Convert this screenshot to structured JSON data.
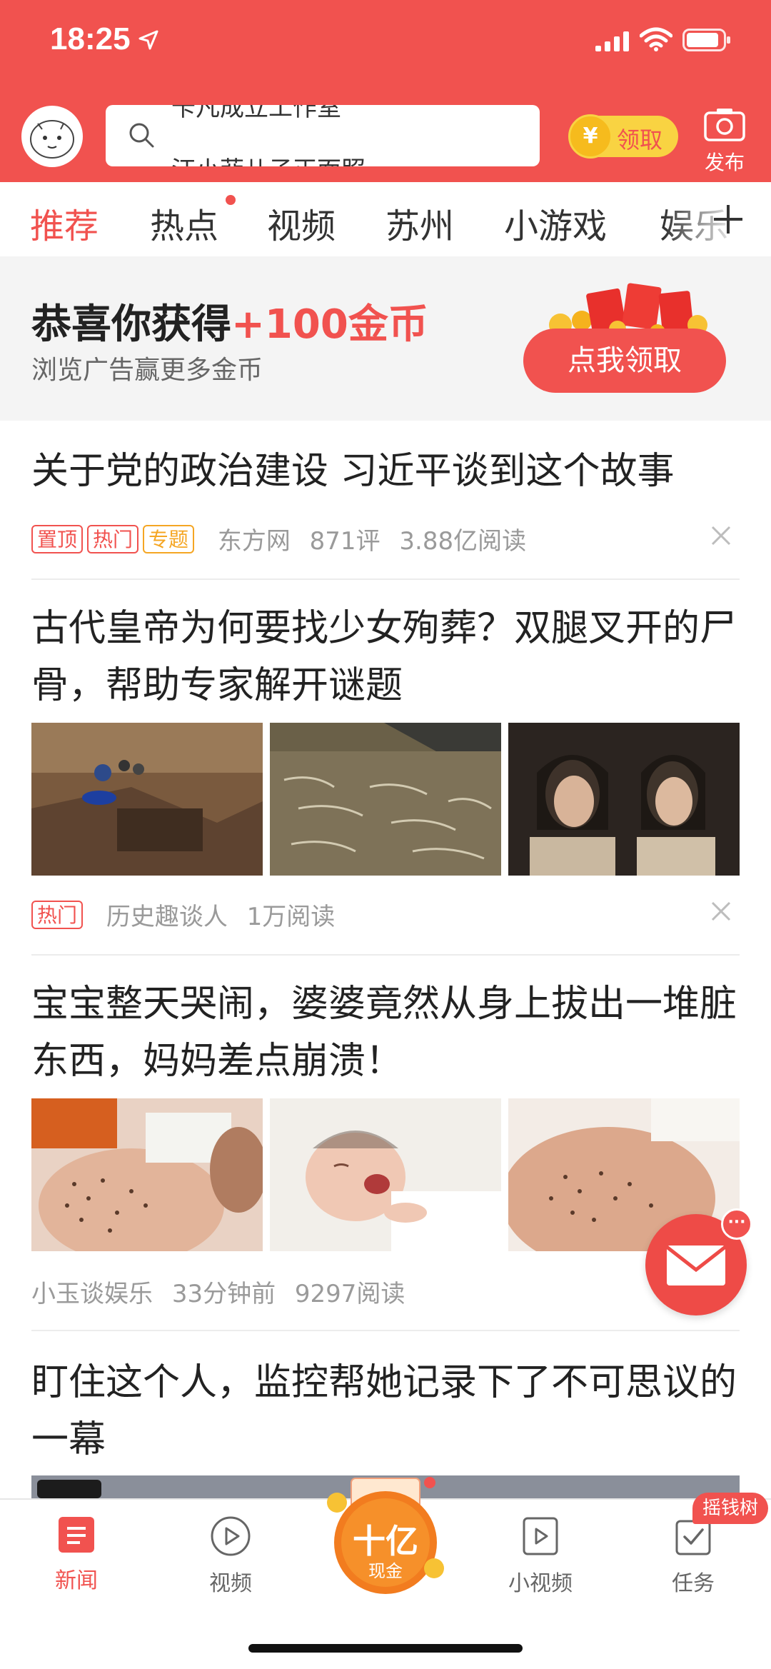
{
  "status_bar": {
    "time": "18:25"
  },
  "header": {
    "search_rolling": [
      "卡凡成立工作室",
      "汪小菲儿子正面照"
    ],
    "coin_symbol": "¥",
    "coin_label": "领取",
    "publish_label": "发布"
  },
  "tabs": [
    "推荐",
    "热点",
    "视频",
    "苏州",
    "小游戏",
    "娱乐"
  ],
  "banner": {
    "title_prefix": "恭喜你获得",
    "title_accent": "+100金币",
    "subtitle": "浏览广告赢更多金币",
    "button": "点我领取"
  },
  "articles": [
    {
      "title": "关于党的政治建设 习近平谈到这个故事",
      "tags": [
        "置顶",
        "热门",
        "专题"
      ],
      "source": "东方网",
      "comments": "871评",
      "reads": "3.88亿阅读"
    },
    {
      "title": "古代皇帝为何要找少女殉葬？双腿叉开的尸骨，帮助专家解开谜题",
      "tags": [
        "热门"
      ],
      "source": "历史趣谈人",
      "reads": "1万阅读"
    },
    {
      "title": "宝宝整天哭闹，婆婆竟然从身上拔出一堆脏东西，妈妈差点崩溃！",
      "source": "小玉谈娱乐",
      "time": "33分钟前",
      "reads": "9297阅读"
    },
    {
      "title": "盯住这个人，监控帮她记录下了不可思议的一幕"
    }
  ],
  "mail_badge": "···",
  "bottom_nav": {
    "items": [
      "新闻",
      "视频",
      "小视频",
      "任务"
    ],
    "center_label": "十亿",
    "center_sub": "现金",
    "shake_badge": "摇钱树"
  },
  "colors": {
    "brand": "#f1524f",
    "tag_orange": "#f5a623"
  }
}
